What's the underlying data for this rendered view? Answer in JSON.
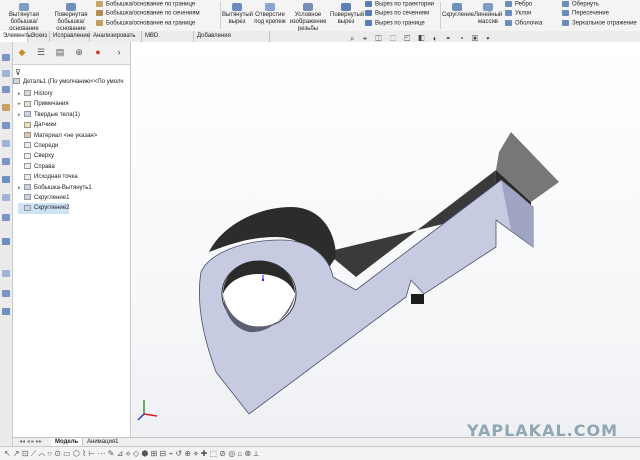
{
  "ribbon": {
    "buttons": [
      {
        "label": "Вытянутая бобышка/основание",
        "icon": "extrude-boss-icon",
        "color": "#7f9ec6"
      },
      {
        "label": "Повернутая бобышка/основание",
        "icon": "revolve-boss-icon",
        "color": "#6f8fbf"
      },
      {
        "label": "Вытянутый вырез",
        "icon": "extrude-cut-icon",
        "color": "#6b8cc0"
      },
      {
        "label": "Отверстие под крепеж",
        "icon": "hole-wizard-icon",
        "color": "#8aa6cf"
      },
      {
        "label": "Условное изображение резьбы",
        "icon": "thread-icon",
        "color": "#7790b8"
      },
      {
        "label": "Повернутый вырез",
        "icon": "revolve-cut-icon",
        "color": "#5d7fb6"
      },
      {
        "label": "Скругление",
        "icon": "fillet-icon",
        "color": "#6e8fc2"
      },
      {
        "label": "Линейный массив",
        "icon": "linear-pattern-icon",
        "color": "#7f9ac4"
      }
    ],
    "small": [
      {
        "label": "Бобышка/основание по границе",
        "icon": "boundary-boss-icon",
        "color": "#caa36a"
      },
      {
        "label": "Бобышка/основание по сечениям",
        "icon": "loft-boss-icon",
        "color": "#b58c53"
      },
      {
        "label": "Бобышка/основание на границе",
        "icon": "boundary-icon",
        "color": "#c49a5e"
      },
      {
        "label": "Вырез по траектории",
        "icon": "sweep-cut-icon",
        "color": "#5c7db4"
      },
      {
        "label": "Вырез по сечениям",
        "icon": "loft-cut-icon",
        "color": "#5c7db4"
      },
      {
        "label": "Вырез по границе",
        "icon": "boundary-cut-icon",
        "color": "#5c7db4"
      },
      {
        "label": "Ребро",
        "icon": "rib-icon",
        "color": "#6d8bbd"
      },
      {
        "label": "Уклон",
        "icon": "draft-icon",
        "color": "#6d8bbd"
      },
      {
        "label": "Оболочка",
        "icon": "shell-icon",
        "color": "#6d8bbd"
      },
      {
        "label": "Обернуть",
        "icon": "wrap-icon",
        "color": "#6d8bbd"
      },
      {
        "label": "Пересечение",
        "icon": "intersect-icon",
        "color": "#6d8bbd"
      },
      {
        "label": "Зеркальное отражение",
        "icon": "mirror-icon",
        "color": "#6d8bbd"
      }
    ]
  },
  "tabs": [
    "Элементы",
    "Эскиз",
    "Исправление",
    "Анализировать",
    "MBD Dimensions",
    "Добавления SOLIDWORKS"
  ],
  "tree": {
    "root": "Деталь1  (По умолчанию<<По умолч",
    "items": [
      {
        "label": "History",
        "caret": "▸"
      },
      {
        "label": "Примечания",
        "caret": "▸"
      },
      {
        "label": "Твердые тела(1)",
        "caret": "▸"
      },
      {
        "label": "Датчики",
        "caret": ""
      },
      {
        "label": "Материал <не указан>",
        "caret": ""
      },
      {
        "label": "Спереди",
        "caret": ""
      },
      {
        "label": "Сверху",
        "caret": ""
      },
      {
        "label": "Справа",
        "caret": ""
      },
      {
        "label": "Исходная точка",
        "caret": ""
      },
      {
        "label": "Бобышка-Вытянуть1",
        "caret": "▸"
      },
      {
        "label": "Скругление1",
        "caret": ""
      },
      {
        "label": "Скругление2",
        "caret": ""
      }
    ],
    "selected_index": 11
  },
  "viewport": {
    "toolbar_glyphs": "⌕ ⌖ ◫ ⬚ ◰ ◧ ◐ ◓ ◔ ▣ ▾",
    "model_color": "#c7cbe2",
    "watermark": "YAPLAKAL.COM"
  },
  "bottom_tabs": [
    "Модель",
    "Анимация1"
  ],
  "status_glyphs": "↖ ↗ ⊡ ⟋ ⌒ ○ ⊙ ▭ ⬡ ⌇ ⊢ ⋯ ✎ ⊿ ⟡ ◇ ⬢ ⊞ ⊟ ⌁ ↺ ⊕ ⋄ ✚ ⬚ ⊘ ◎ ⌂ ⊗ ⟂"
}
